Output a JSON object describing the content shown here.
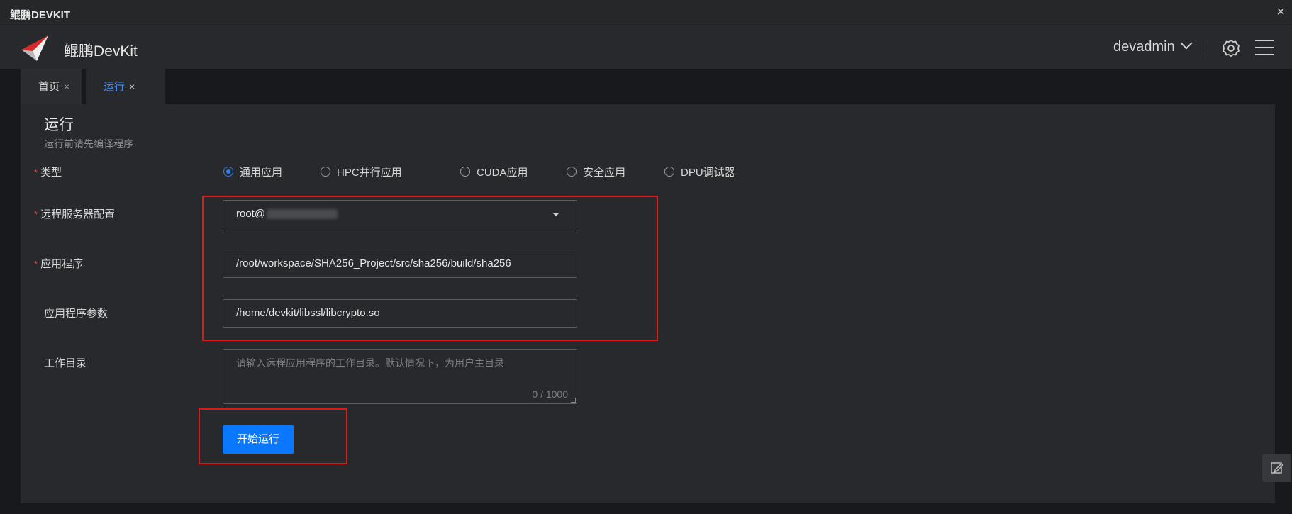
{
  "window": {
    "title": "鲲鹏DEVKIT",
    "close": "×"
  },
  "header": {
    "app_name": "鲲鹏DevKit",
    "user": "devadmin"
  },
  "tabs": [
    {
      "label": "首页",
      "close": "×"
    },
    {
      "label": "运行",
      "close": "×"
    }
  ],
  "page": {
    "title": "运行",
    "subtitle": "运行前请先编译程序",
    "required_mark": "*",
    "type": {
      "label": "类型",
      "options": [
        "通用应用",
        "HPC并行应用",
        "CUDA应用",
        "安全应用",
        "DPU调试器"
      ],
      "selected": "通用应用"
    },
    "server": {
      "label": "远程服务器配置",
      "value": "root@"
    },
    "app": {
      "label": "应用程序",
      "value": "/root/workspace/SHA256_Project/src/sha256/build/sha256"
    },
    "args": {
      "label": "应用程序参数",
      "value": "/home/devkit/libssl/libcrypto.so"
    },
    "workdir": {
      "label": "工作目录",
      "placeholder": "请输入远程应用程序的工作目录。默认情况下，为用户主目录",
      "counter": "0 / 1000"
    },
    "run_button": "开始运行"
  },
  "icons": {
    "logo": "kunpeng-logo-icon",
    "gear": "gear-icon",
    "menu": "hamburger-menu-icon",
    "feedback": "edit-feedback-icon"
  },
  "colors": {
    "accent": "#0a77ff",
    "highlight_box": "#e01818",
    "required": "#e04848"
  }
}
